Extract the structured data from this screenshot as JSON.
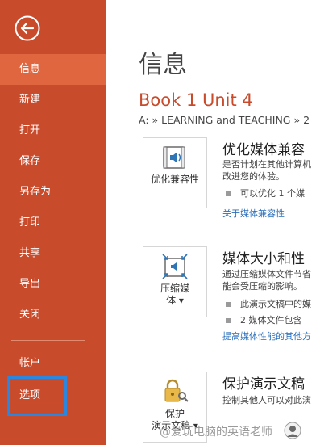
{
  "sidebar": {
    "items": [
      {
        "label": "信息"
      },
      {
        "label": "新建"
      },
      {
        "label": "打开"
      },
      {
        "label": "保存"
      },
      {
        "label": "另存为"
      },
      {
        "label": "打印"
      },
      {
        "label": "共享"
      },
      {
        "label": "导出"
      },
      {
        "label": "关闭"
      },
      {
        "label": "帐户"
      },
      {
        "label": "选项"
      }
    ]
  },
  "main": {
    "title": "信息",
    "doc_title": "Book 1 Unit 4",
    "path": "A: » LEARNING and TEACHING » 2",
    "sections": [
      {
        "card_label": "优化兼容性",
        "title": "优化媒体兼容",
        "desc": [
          "是否计划在其他计算机",
          "改进您的体验。"
        ],
        "bullets": [
          "可以优化 1 个媒"
        ],
        "link": "关于媒体兼容性"
      },
      {
        "card_label_1": "压缩媒",
        "card_label_2": "体 ▾",
        "title": "媒体大小和性",
        "desc": [
          "通过压缩媒体文件节省",
          "能会受压缩的影响。"
        ],
        "bullets": [
          "此演示文稿中的媒",
          "2 媒体文件包含"
        ],
        "link": "提高媒体性能的其他方"
      },
      {
        "card_label_1": "保护",
        "card_label_2": "演示文稿 ▾",
        "title": "保护演示文稿",
        "desc": [
          "控制其他人可以对此演"
        ]
      }
    ]
  },
  "watermark": "@爱玩电脑的英语老师",
  "colors": {
    "sidebar": "#c84b2c",
    "active": "#e0663f",
    "accent": "#c84b2c",
    "link": "#2a6ebb",
    "highlight": "#2b86e0"
  }
}
